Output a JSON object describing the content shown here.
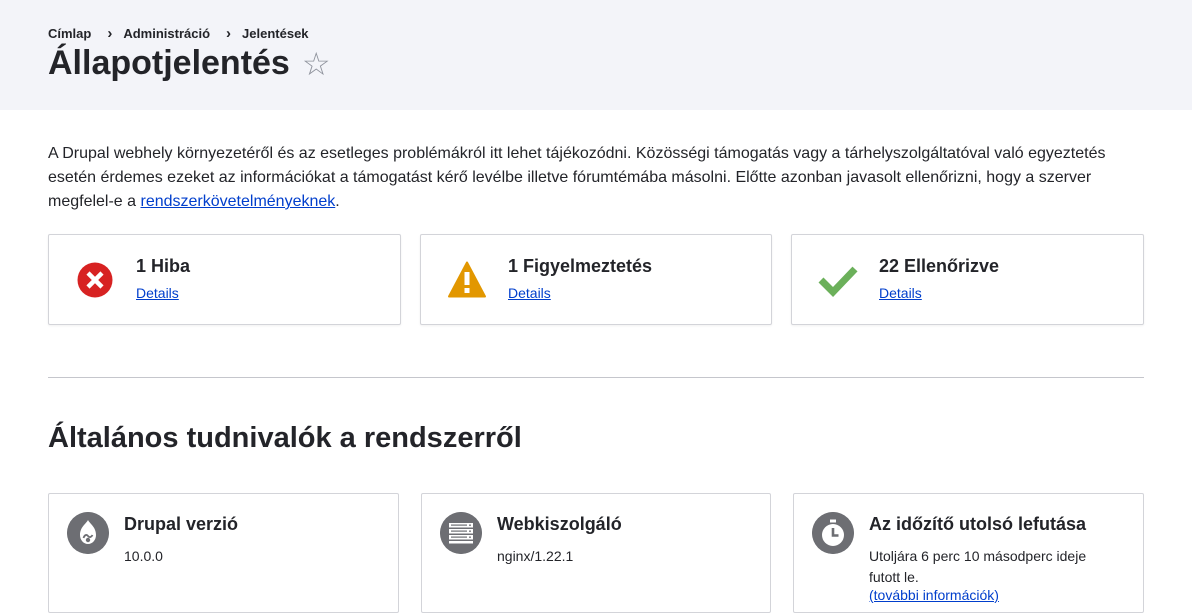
{
  "breadcrumb": {
    "items": [
      "Címlap",
      "Administráció",
      "Jelentések"
    ],
    "separator": "›"
  },
  "page": {
    "title": "Állapotjelentés",
    "star": "☆"
  },
  "intro": {
    "text": "A Drupal webhely környezetéről és az esetleges problémákról itt lehet tájékozódni. Közösségi támogatás vagy a tárhelyszolgáltatóval való egyeztetés esetén érdemes ezeket az információkat a támogatást kérő levélbe illetve fórumtémába másolni. Előtte azonban javasolt ellenőrizni, hogy a szerver megfelel-e a ",
    "link": "rendszerkövetelményeknek",
    "end": "."
  },
  "status": {
    "error": {
      "title": "1 Hiba",
      "details": "Details",
      "icon": "error-icon",
      "color": "#d72222"
    },
    "warning": {
      "title": "1 Figyelmeztetés",
      "details": "Details",
      "icon": "warning-icon",
      "color": "#e29700"
    },
    "checked": {
      "title": "22 Ellenőrizve",
      "details": "Details",
      "icon": "check-icon",
      "color": "#6bb05a"
    }
  },
  "general": {
    "title": "Általános tudnivalók a rendszerről",
    "drupal": {
      "title": "Drupal verzió",
      "value": "10.0.0",
      "icon": "drupal-icon"
    },
    "webserver": {
      "title": "Webkiszolgáló",
      "value": "nginx/1.22.1",
      "icon": "server-icon"
    },
    "cron": {
      "title": "Az időzítő utolsó lefutása",
      "value": "Utoljára 6 perc 10 másodperc ideje futott le.",
      "more": "(további információk)",
      "icon": "timer-icon"
    }
  },
  "colors": {
    "link": "#003ecc",
    "header_bg": "#f3f4f9",
    "icon_gray": "#6d6e73"
  }
}
